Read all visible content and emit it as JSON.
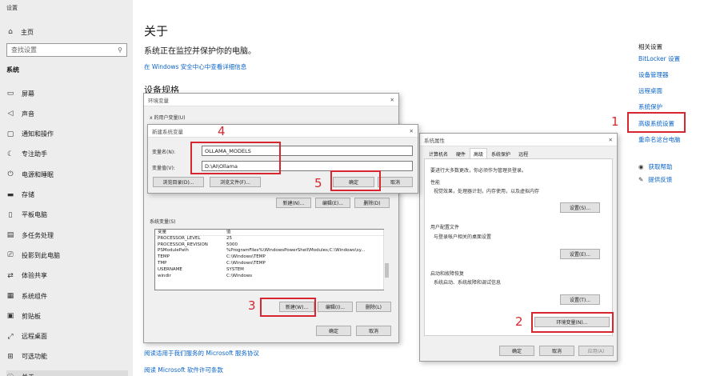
{
  "window_title": "设置",
  "sidebar": {
    "home": "主页",
    "search_placeholder": "查找设置",
    "section": "系统",
    "items": [
      {
        "label": "屏幕",
        "icon": "monitor-icon"
      },
      {
        "label": "声音",
        "icon": "speaker-icon"
      },
      {
        "label": "通知和操作",
        "icon": "notification-icon"
      },
      {
        "label": "专注助手",
        "icon": "moon-icon"
      },
      {
        "label": "电源和睡眠",
        "icon": "power-icon"
      },
      {
        "label": "存储",
        "icon": "storage-icon"
      },
      {
        "label": "平板电脑",
        "icon": "tablet-icon"
      },
      {
        "label": "多任务处理",
        "icon": "multitask-icon"
      },
      {
        "label": "投影到此电脑",
        "icon": "project-icon"
      },
      {
        "label": "体验共享",
        "icon": "share-icon"
      },
      {
        "label": "系统组件",
        "icon": "component-icon"
      },
      {
        "label": "剪贴板",
        "icon": "clipboard-icon"
      },
      {
        "label": "远程桌面",
        "icon": "remote-icon"
      },
      {
        "label": "可选功能",
        "icon": "optional-icon"
      },
      {
        "label": "关于",
        "icon": "info-icon"
      }
    ]
  },
  "main": {
    "title": "关于",
    "subtitle": "系统正在监控并保护你的电脑。",
    "security_link": "在 Windows 安全中心中查看详细信息",
    "device_spec": "设备规格",
    "link_ms_agreement": "阅读适用于我们服务的 Microsoft 服务协议",
    "link_ms_license": "阅读 Microsoft 软件许可条款"
  },
  "related": {
    "title": "相关设置",
    "links": [
      "BitLocker 设置",
      "设备管理器",
      "远程桌面",
      "系统保护",
      "高级系统设置",
      "重命名这台电脑"
    ],
    "help": "获取帮助",
    "feedback": "提供反馈"
  },
  "env_dialog": {
    "title": "环境变量",
    "user_vars_label": "x 的用户变量(U)",
    "user_buttons": [
      "新建(N)...",
      "编辑(E)...",
      "删除(D)"
    ],
    "sys_vars_label": "系统变量(S)",
    "col_var": "变量",
    "col_val": "值",
    "rows": [
      {
        "name": "PROCESSOR_LEVEL",
        "value": "25"
      },
      {
        "name": "PROCESSOR_REVISION",
        "value": "5000"
      },
      {
        "name": "PSModulePath",
        "value": "%ProgramFiles%\\WindowsPowerShell\\Modules;C:\\Windows\\sy..."
      },
      {
        "name": "TEMP",
        "value": "C:\\Windows\\TEMP"
      },
      {
        "name": "TMP",
        "value": "C:\\Windows\\TEMP"
      },
      {
        "name": "USERNAME",
        "value": "SYSTEM"
      },
      {
        "name": "windir",
        "value": "C:\\Windows"
      }
    ],
    "sys_new": "新建(W)...",
    "sys_edit": "编辑(I)...",
    "sys_delete": "删除(L)",
    "ok": "确定",
    "cancel": "取消"
  },
  "new_var_dialog": {
    "title": "新建系统变量",
    "name_label": "变量名(N):",
    "name_value": "OLLAMA_MODELS",
    "value_label": "变量值(V):",
    "value_value": "D:\\AI\\Ollama",
    "browse_dir": "浏览目录(D)...",
    "browse_file": "浏览文件(F)...",
    "ok": "确定",
    "cancel": "取消"
  },
  "sys_props": {
    "title": "系统属性",
    "tabs": [
      "计算机名",
      "硬件",
      "高级",
      "系统保护",
      "远程"
    ],
    "admin_note": "要进行大多数更改，你必须作为管理员登录。",
    "perf_title": "性能",
    "perf_desc": "视觉效果，处理器计划，内存使用，以及虚拟内存",
    "profile_title": "用户配置文件",
    "profile_desc": "与登录帐户相关的桌面设置",
    "startup_title": "启动和故障恢复",
    "startup_desc": "系统启动、系统故障和调试信息",
    "settings_btn": "设置(S)...",
    "settings_btn2": "设置(E)...",
    "settings_btn3": "设置(T)...",
    "env_btn": "环境变量(N)...",
    "ok": "确定",
    "cancel": "取消",
    "apply": "应用(A)"
  },
  "annotations": {
    "n1": "1",
    "n2": "2",
    "n3": "3",
    "n4": "4",
    "n5": "5"
  },
  "colors": {
    "accent_link": "#0a64c8",
    "annotation_red": "#d7262d"
  }
}
